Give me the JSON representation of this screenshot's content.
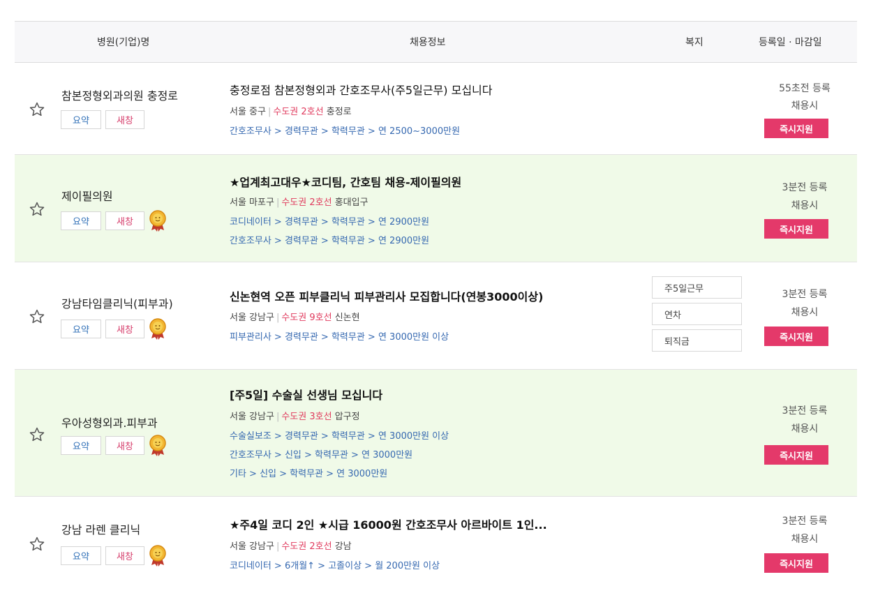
{
  "header": {
    "name": "병원(기업)명",
    "info": "채용정보",
    "welfare": "복지",
    "date": "등록일 · 마감일"
  },
  "buttons": {
    "summary": "요약",
    "new_window": "새창",
    "apply": "즉시지원"
  },
  "colors": {
    "accent": "#e4396a",
    "subway": "#e0395c",
    "link": "#3568b0",
    "highlight_row": "#f0fae8"
  },
  "rows": [
    {
      "company": "참본정형외과의원 충정로",
      "title": "충정로점 참본정형외과 간호조무사(주5일근무) 모십니다",
      "region": "서울 중구",
      "subway": "수도권 2호선",
      "station": "충정로",
      "conditions": [
        "간호조무사 > 경력무관 > 학력무관 > 연 2500~3000만원"
      ],
      "posted": "55초전 등록",
      "deadline": "채용시",
      "welfare": []
    },
    {
      "company": "제이필의원",
      "title": "★업계최고대우★코디팀, 간호팀 채용-제이필의원",
      "region": "서울 마포구",
      "subway": "수도권 2호선",
      "station": "홍대입구",
      "conditions": [
        "코디네이터 > 경력무관 > 학력무관 > 연 2900만원",
        "간호조무사 > 경력무관 > 학력무관 > 연 2900만원"
      ],
      "posted": "3분전 등록",
      "deadline": "채용시",
      "welfare": []
    },
    {
      "company": "강남타임클리닉(피부과)",
      "title": "신논현역 오픈 피부클리닉 피부관리사 모집합니다(연봉3000이상)",
      "region": "서울 강남구",
      "subway": "수도권 9호선",
      "station": "신논현",
      "conditions": [
        "피부관리사 > 경력무관 > 학력무관 > 연 3000만원 이상"
      ],
      "posted": "3분전 등록",
      "deadline": "채용시",
      "welfare": [
        "주5일근무",
        "연차",
        "퇴직금"
      ]
    },
    {
      "company": "우아성형외과.피부과",
      "title": "[주5일] 수술실 선생님 모십니다",
      "region": "서울 강남구",
      "subway": "수도권 3호선",
      "station": "압구정",
      "conditions": [
        "수술실보조 > 경력무관 > 학력무관 > 연 3000만원 이상",
        "간호조무사 > 신입 > 학력무관 > 연 3000만원",
        "기타 > 신입 > 학력무관 > 연 3000만원"
      ],
      "posted": "3분전 등록",
      "deadline": "채용시",
      "welfare": []
    },
    {
      "company": "강남 라렌 클리닉",
      "title": "★주4일 코디 2인 ★시급 16000원 간호조무사 아르바이트 1인...",
      "region": "서울 강남구",
      "subway": "수도권 2호선",
      "station": "강남",
      "conditions": [
        "코디네이터 > 6개월↑ > 고졸이상 > 월 200만원 이상"
      ],
      "posted": "3분전 등록",
      "deadline": "채용시",
      "welfare": []
    }
  ]
}
